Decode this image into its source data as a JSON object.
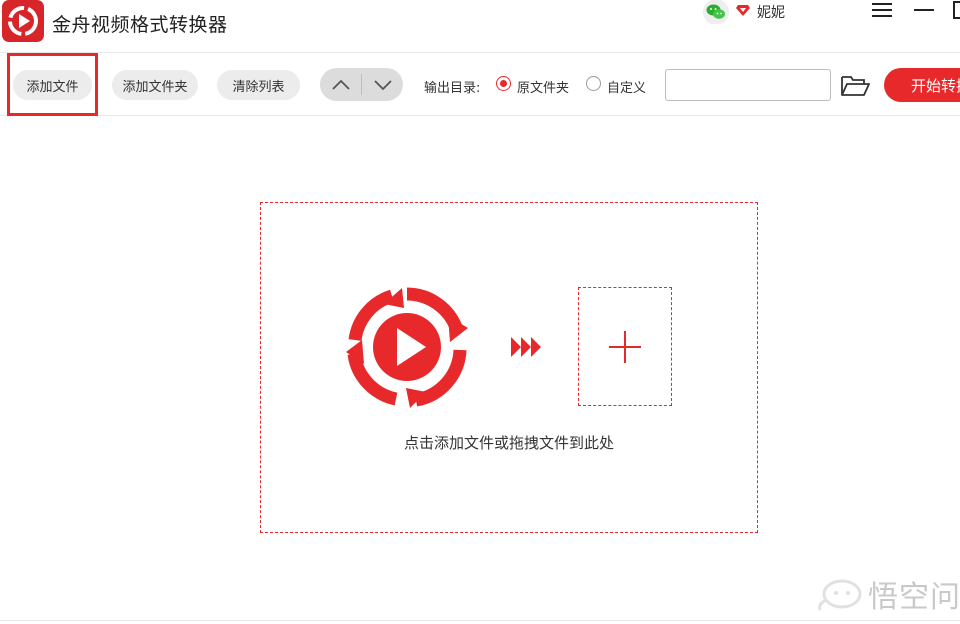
{
  "app": {
    "title": "金舟视频格式转换器"
  },
  "user": {
    "name": "妮妮"
  },
  "toolbar": {
    "add_file_label": "添加文件",
    "add_folder_label": "添加文件夹",
    "clear_list_label": "清除列表",
    "output_dir_label": "输出目录:",
    "output_options": [
      {
        "label": "原文件夹",
        "selected": true
      },
      {
        "label": "自定义",
        "selected": false
      }
    ],
    "custom_path_value": "",
    "start_label": "开始转换"
  },
  "drop_zone": {
    "hint": "点击添加文件或拖拽文件到此处"
  },
  "watermark": {
    "text": "悟空问答"
  },
  "colors": {
    "accent": "#e8292b",
    "pill_bg": "#ececec",
    "nav_bg": "#dcdcdc"
  },
  "icons": [
    "app-logo-icon",
    "wechat-icon",
    "vip-diamond-icon",
    "menu-icon",
    "minimize-icon",
    "maximize-icon",
    "chevron-up-icon",
    "chevron-down-icon",
    "folder-open-icon",
    "video-convert-icon",
    "triple-arrow-icon",
    "plus-icon"
  ]
}
